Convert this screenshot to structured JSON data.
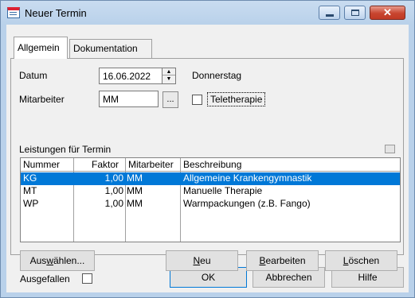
{
  "window": {
    "title": "Neuer Termin",
    "icon": "calendar-icon"
  },
  "tabs": [
    {
      "label": "Allgemein",
      "active": true
    },
    {
      "label": "Dokumentation",
      "active": false
    }
  ],
  "form": {
    "datum_label": "Datum",
    "datum_value": "16.06.2022",
    "weekday": "Donnerstag",
    "mitarbeiter_label": "Mitarbeiter",
    "mitarbeiter_value": "MM",
    "browse_label": "...",
    "teletherapie_label": "Teletherapie",
    "teletherapie_checked": false
  },
  "services": {
    "section_label": "Leistungen für Termin",
    "columns": [
      "Nummer",
      "Faktor",
      "Mitarbeiter",
      "Beschreibung"
    ],
    "rows": [
      {
        "nummer": "KG",
        "faktor": "1,00",
        "mitarbeiter": "MM",
        "beschreibung": "Allgemeine Krankengymnastik",
        "selected": true
      },
      {
        "nummer": "MT",
        "faktor": "1,00",
        "mitarbeiter": "MM",
        "beschreibung": "Manuelle Therapie",
        "selected": false
      },
      {
        "nummer": "WP",
        "faktor": "1,00",
        "mitarbeiter": "MM",
        "beschreibung": "Warmpackungen (z.B. Fango)",
        "selected": false
      }
    ]
  },
  "buttons": {
    "auswaehlen_pre": "Aus",
    "auswaehlen_u": "w",
    "auswaehlen_post": "ählen...",
    "neu_u": "N",
    "neu_post": "eu",
    "bearbeiten_u": "B",
    "bearbeiten_post": "earbeiten",
    "loeschen_u": "L",
    "loeschen_post": "öschen",
    "ok": "OK",
    "abbrechen": "Abbrechen",
    "hilfe": "Hilfe"
  },
  "footer": {
    "ausgefallen_label": "Ausgefallen",
    "ausgefallen_checked": false
  },
  "colors": {
    "selection": "#0078d7",
    "titlebar": "#b9d1ea",
    "close_button": "#c8452f"
  }
}
